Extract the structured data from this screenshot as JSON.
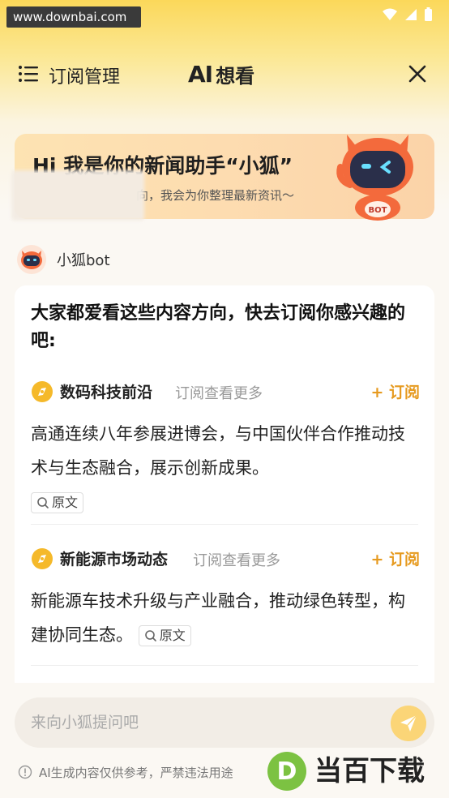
{
  "status_bar": {
    "watermark": "www.downbai.com"
  },
  "header": {
    "menu_label": "订阅管理",
    "brand_ai": "AI",
    "brand_text": "想看"
  },
  "banner": {
    "title": "Hi 我是你的新闻助手“小狐”",
    "subtitle": "向，我会为你整理最新资讯～",
    "mascot_badge": "BOT"
  },
  "bot": {
    "name": "小狐bot"
  },
  "card": {
    "title": "大家都爱看这些内容方向，快去订阅你感兴趣的吧:",
    "topics": [
      {
        "name": "数码科技前沿",
        "more": "订阅查看更多",
        "subscribe": "+ 订阅",
        "body": "高通连续八年参展进博会，与中国伙伴合作推动技术与生态融合，展示创新成果。",
        "source": "原文"
      },
      {
        "name": "新能源市场动态",
        "more": "订阅查看更多",
        "subscribe": "+ 订阅",
        "body": "新能源车技术升级与产业融合，推动绿色转型，构建协同生态。",
        "source": "原文"
      }
    ]
  },
  "input": {
    "placeholder": "来向小狐提问吧"
  },
  "disclaimer": "AI生成内容仅供参考，严禁违法用途",
  "footer_logo": {
    "letter": "D",
    "text": "当百下载"
  },
  "colors": {
    "accent": "#e69a1f",
    "topic_icon": "#f5b92a",
    "send": "#fbd577"
  }
}
